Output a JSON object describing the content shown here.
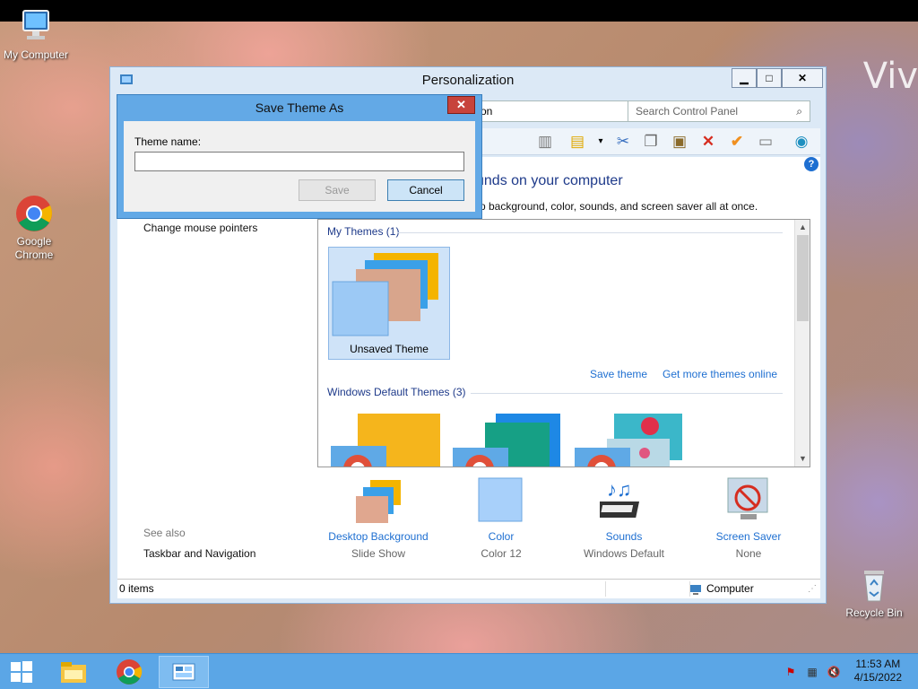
{
  "desktop": {
    "icons": [
      {
        "label": "My Computer"
      },
      {
        "label": "Google Chrome"
      },
      {
        "label": "Recycle Bin"
      }
    ],
    "watermark": "Viv"
  },
  "window": {
    "title": "Personalization",
    "controls": {
      "minimize": "▁",
      "maximize": "□",
      "close": "✕"
    },
    "address_text": "on",
    "search_placeholder": "Search Control Panel",
    "heading": "unds on your computer",
    "subtext": "p background, color, sounds, and screen saver all at once.",
    "help": "?",
    "left_links": [
      "Change mouse pointers"
    ],
    "see_also_title": "See also",
    "see_also_links": [
      "Taskbar and Navigation"
    ],
    "my_themes_title": "My Themes (1)",
    "unsaved_theme_label": "Unsaved Theme",
    "save_theme_link": "Save theme",
    "get_more_themes_link": "Get more themes online",
    "default_themes_title": "Windows Default Themes (3)",
    "bottom_items": [
      {
        "label": "Desktop Background",
        "value": "Slide Show"
      },
      {
        "label": "Color",
        "value": "Color 12"
      },
      {
        "label": "Sounds",
        "value": "Windows Default"
      },
      {
        "label": "Screen Saver",
        "value": "None"
      }
    ],
    "status_items": "0 items",
    "status_location": "Computer"
  },
  "dialog": {
    "title": "Save Theme As",
    "close": "✕",
    "label": "Theme name:",
    "input_value": "",
    "save_label": "Save",
    "cancel_label": "Cancel"
  },
  "taskbar": {
    "time": "11:53 AM",
    "date": "4/15/2022"
  },
  "colors": {
    "accent": "#1e6fd1",
    "taskbar": "#5ba6e6",
    "dialog_frame": "#63a9e6",
    "close_red": "#c7433b"
  }
}
